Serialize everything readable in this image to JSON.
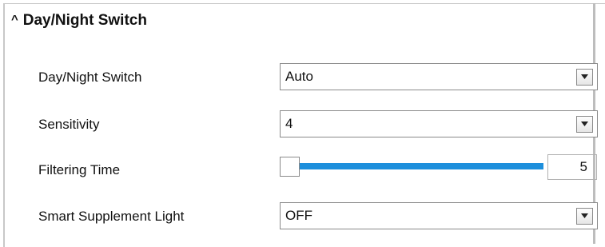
{
  "section": {
    "title": "Day/Night Switch",
    "collapse_icon": "caret-up-icon"
  },
  "fields": {
    "day_night_switch": {
      "label": "Day/Night Switch",
      "value": "Auto"
    },
    "sensitivity": {
      "label": "Sensitivity",
      "value": "4"
    },
    "filtering_time": {
      "label": "Filtering Time",
      "value": "5",
      "slider_fraction": 0.0
    },
    "smart_supplement_light": {
      "label": "Smart Supplement Light",
      "value": "OFF"
    }
  },
  "colors": {
    "slider_fill": "#1d8fdc",
    "border": "#8a8a8a"
  }
}
